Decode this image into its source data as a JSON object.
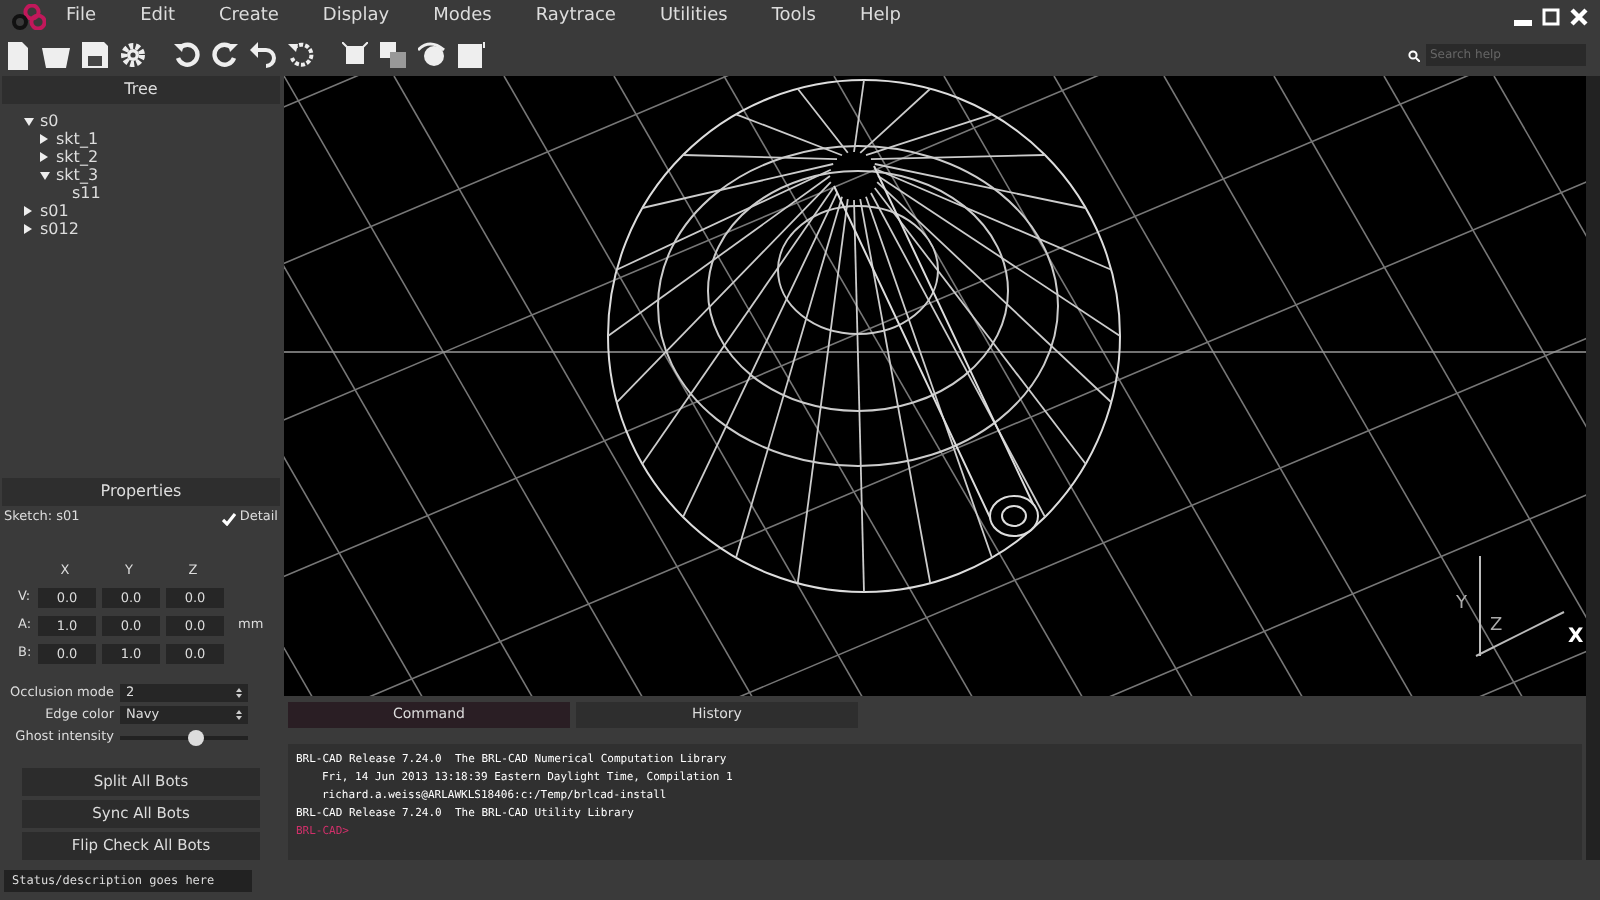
{
  "menu": [
    "File",
    "Edit",
    "Create",
    "Display",
    "Modes",
    "Raytrace",
    "Utilities",
    "Tools",
    "Help"
  ],
  "search": {
    "placeholder": "Search help"
  },
  "tree": {
    "title": "Tree",
    "items": [
      {
        "label": "s0",
        "expanded": true,
        "children": [
          {
            "label": "skt_1",
            "expanded": false
          },
          {
            "label": "skt_2",
            "expanded": false
          },
          {
            "label": "skt_3",
            "expanded": true,
            "children": [
              {
                "label": "s11"
              }
            ]
          }
        ]
      },
      {
        "label": "s01",
        "expanded": false
      },
      {
        "label": "s012",
        "expanded": false
      }
    ]
  },
  "properties": {
    "title": "Properties",
    "sketch": "Sketch: s01",
    "detail": {
      "label": "Detail",
      "checked": true
    },
    "columns": [
      "X",
      "Y",
      "Z"
    ],
    "rows": [
      {
        "label": "V:",
        "values": [
          "0.0",
          "0.0",
          "0.0"
        ]
      },
      {
        "label": "A:",
        "values": [
          "1.0",
          "0.0",
          "0.0"
        ],
        "unit": "mm"
      },
      {
        "label": "B:",
        "values": [
          "0.0",
          "1.0",
          "0.0"
        ]
      }
    ],
    "occlusion": {
      "label": "Occlusion mode",
      "value": "2"
    },
    "edge_color": {
      "label": "Edge color",
      "value": "Navy"
    },
    "ghost": {
      "label": "Ghost intensity",
      "level": 0.6
    },
    "buttons": [
      "Split All Bots",
      "Sync All Bots",
      "Flip Check All Bots"
    ]
  },
  "viewport": {
    "axes": [
      "Y",
      "Z",
      "X"
    ]
  },
  "console": {
    "tabs": [
      {
        "label": "Command",
        "selected": true
      },
      {
        "label": "History",
        "selected": false
      }
    ],
    "lines": [
      {
        "kind": "output",
        "text": "BRL-CAD Release 7.24.0  The BRL-CAD Numerical Computation Library"
      },
      {
        "kind": "indent",
        "text": "Fri, 14 Jun 2013 13:18:39 Eastern Daylight Time, Compilation 1"
      },
      {
        "kind": "indent",
        "text": "richard.a.weiss@ARLAWKLS18406:c:/Temp/brlcad-install"
      },
      {
        "kind": "output",
        "text": "BRL-CAD Release 7.24.0  The BRL-CAD Utility Library"
      },
      {
        "kind": "prompt",
        "text": "BRL-CAD>"
      }
    ]
  },
  "status_bar": "Status/description goes here"
}
